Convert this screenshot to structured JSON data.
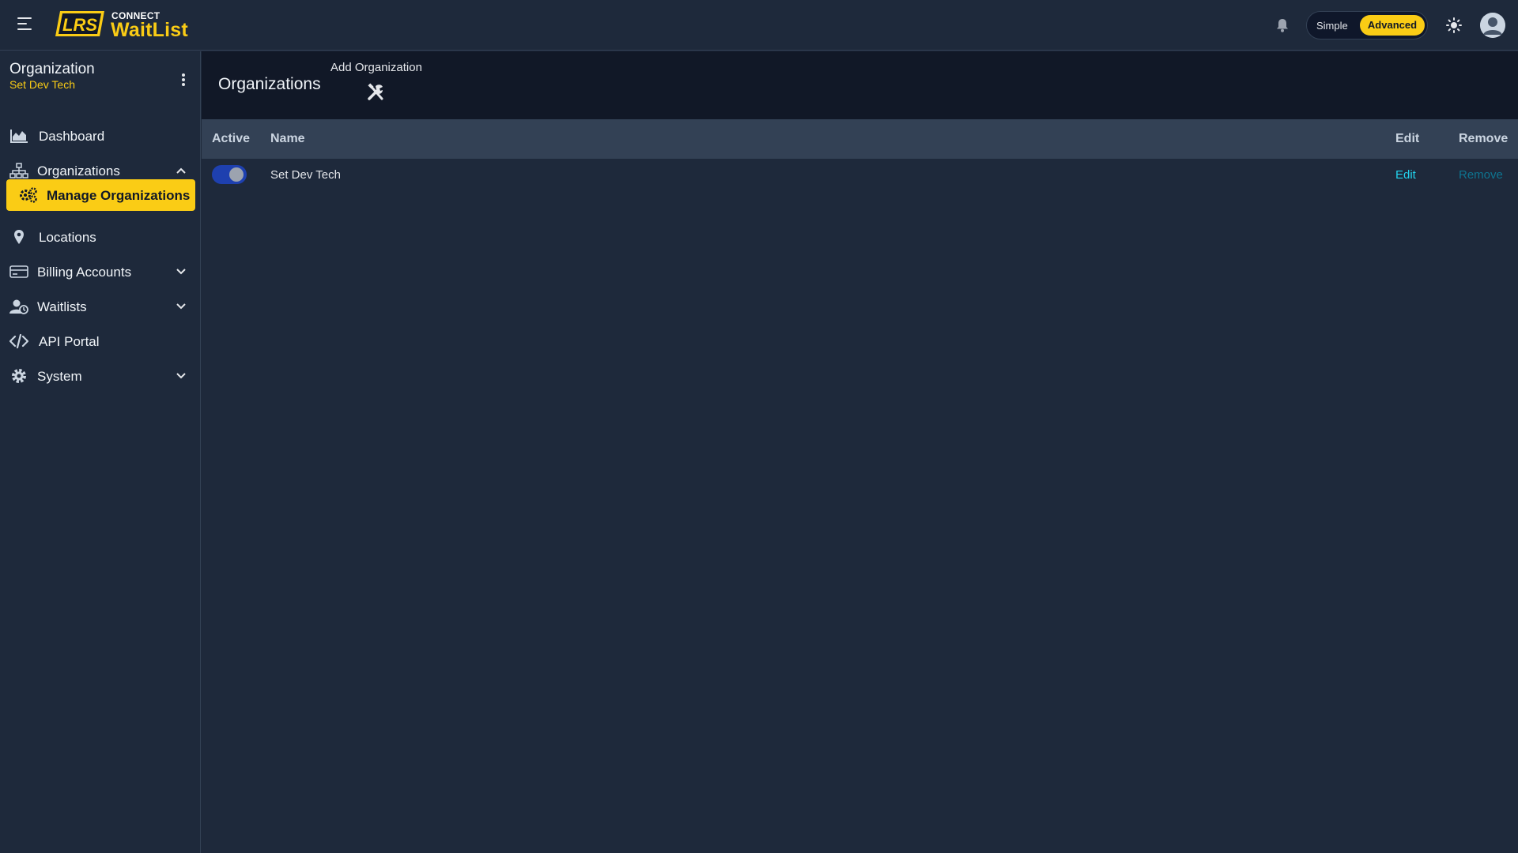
{
  "topbar": {
    "brand_small": "CONNECT",
    "brand_big": "WaitList",
    "logo_text": "LRS",
    "mode_simple": "Simple",
    "mode_advanced": "Advanced",
    "active_mode": "Advanced"
  },
  "sidebar": {
    "org_label": "Organization",
    "org_name": "Set Dev Tech",
    "items": [
      {
        "label": "Dashboard",
        "icon": "chart-area-icon"
      },
      {
        "label": "Organizations",
        "icon": "sitemap-icon",
        "expanded": true
      },
      {
        "label": "Manage Organizations",
        "icon": "gears-icon",
        "active": true
      },
      {
        "label": "Locations",
        "icon": "map-pin-icon"
      },
      {
        "label": "Billing Accounts",
        "icon": "credit-card-icon"
      },
      {
        "label": "Waitlists",
        "icon": "user-clock-icon"
      },
      {
        "label": "API Portal",
        "icon": "code-icon"
      },
      {
        "label": "System",
        "icon": "gear-icon"
      }
    ]
  },
  "main": {
    "title": "Organizations",
    "add_label": "Add Organization",
    "columns": {
      "active": "Active",
      "name": "Name",
      "edit": "Edit",
      "remove": "Remove"
    },
    "rows": [
      {
        "active": true,
        "name": "Set Dev Tech",
        "edit": "Edit",
        "remove": "Remove"
      }
    ]
  },
  "colors": {
    "accent": "#facc15",
    "link": "#22d3ee",
    "background": "#1e293b"
  }
}
